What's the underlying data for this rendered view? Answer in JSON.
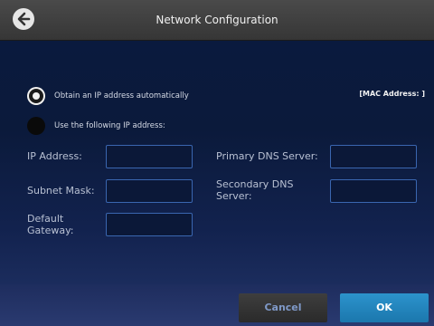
{
  "header": {
    "title": "Network Configuration",
    "back_icon": "back-arrow-icon"
  },
  "ip_mode": {
    "auto_label": "Obtain an IP address automatically",
    "manual_label": "Use the following IP address:",
    "selected": "auto"
  },
  "mac": {
    "text": "[MAC Address: ]"
  },
  "fields": {
    "ip_address": {
      "label": "IP Address:",
      "value": ""
    },
    "subnet_mask": {
      "label": "Subnet Mask:",
      "value": ""
    },
    "default_gateway": {
      "label_line1": "Default",
      "label_line2": "Gateway:",
      "value": ""
    },
    "primary_dns": {
      "label": "Primary DNS Server:",
      "value": ""
    },
    "secondary_dns": {
      "label_line1": "Secondary DNS",
      "label_line2": "Server:",
      "value": ""
    }
  },
  "buttons": {
    "cancel": "Cancel",
    "ok": "OK"
  },
  "colors": {
    "accent_ok": "#2187bf",
    "input_border": "#3a66b0",
    "titlebar": "#3f3f3f"
  }
}
